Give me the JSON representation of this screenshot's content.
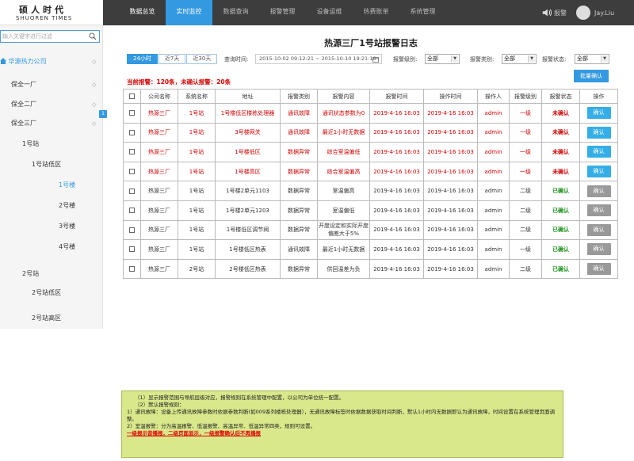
{
  "logo": {
    "cn": "硕人时代",
    "en": "SHUOREN TIMES"
  },
  "nav": [
    {
      "label": "数据总览"
    },
    {
      "label": "实时监控"
    },
    {
      "label": "数据查询"
    },
    {
      "label": "报警管理"
    },
    {
      "label": "设备运维"
    },
    {
      "label": "热费账单"
    },
    {
      "label": "系统管理"
    }
  ],
  "header": {
    "alarm": "报警",
    "user": "Jay.Liu"
  },
  "sidebar": {
    "search_placeholder": "输入关键字进行过滤",
    "company": "华源热力公司",
    "items": [
      "保全一厂",
      "保全二厂",
      "保全三厂",
      "1号站",
      "1号站低区",
      "1号楼",
      "2号楼",
      "3号楼",
      "4号楼",
      "2号站",
      "2号站低区",
      "2号站高区"
    ],
    "badge": "1"
  },
  "panel": {
    "title": "热源三厂1号站报警日志",
    "tabs": [
      "24小时",
      "近7天",
      "近30天"
    ],
    "query_label": "查询时间:",
    "date_range": "2015-10-02 09:12:21 ~ 2015-10-10 19:21:10",
    "level_label": "报警级别:",
    "type_label": "报警类别:",
    "status_label": "报警状态:",
    "select_value": "全部",
    "summary": "当前报警：120条，未确认报警：20条",
    "batch_confirm": "批量确认"
  },
  "table": {
    "headers": [
      "公司名称",
      "系统名称",
      "地址",
      "报警类别",
      "报警内容",
      "报警时间",
      "操作时间",
      "操作人",
      "报警级别",
      "报警状态",
      "操作"
    ],
    "confirm_label": "确认",
    "rows": [
      {
        "company": "热源三厂",
        "system": "1号站",
        "address": "1号楼低区楼栋处理器",
        "type": "通讯故障",
        "content": "通讯状态参数为0",
        "alarm_time": "2019-4-16 16:03",
        "op_time": "2019-4-16 16:03",
        "operator": "admin",
        "level": "一级",
        "status": "未确认"
      },
      {
        "company": "热源三厂",
        "system": "1号站",
        "address": "3号楼网关",
        "type": "通讯故障",
        "content": "最近1小时无数据",
        "alarm_time": "2019-4-16 16:03",
        "op_time": "2019-4-16 16:03",
        "operator": "admin",
        "level": "一级",
        "status": "未确认"
      },
      {
        "company": "热源三厂",
        "system": "1号站",
        "address": "1号楼低区",
        "type": "数据异常",
        "content": "综合室温偏低",
        "alarm_time": "2019-4-16 16:03",
        "op_time": "2019-4-16 16:03",
        "operator": "admin",
        "level": "一级",
        "status": "未确认"
      },
      {
        "company": "热源三厂",
        "system": "1号站",
        "address": "1号楼高区",
        "type": "数据异常",
        "content": "综合室温偏高",
        "alarm_time": "2019-4-16 16:03",
        "op_time": "2019-4-16 16:03",
        "operator": "admin",
        "level": "一级",
        "status": "未确认"
      },
      {
        "company": "热源三厂",
        "system": "1号站",
        "address": "1号楼2单元1103",
        "type": "数据异常",
        "content": "室温偏高",
        "alarm_time": "2019-4-16 16:03",
        "op_time": "2019-4-16 16:03",
        "operator": "admin",
        "level": "二级",
        "status": "已确认"
      },
      {
        "company": "热源三厂",
        "system": "1号站",
        "address": "1号楼2单元1203",
        "type": "数据异常",
        "content": "室温偏低",
        "alarm_time": "2019-4-16 16:03",
        "op_time": "2019-4-16 16:03",
        "operator": "admin",
        "level": "二级",
        "status": "已确认"
      },
      {
        "company": "热源三厂",
        "system": "1号站",
        "address": "1号楼低区调节阀",
        "type": "数据异常",
        "content": "开度设定和实际开度偏差大于5%",
        "alarm_time": "2019-4-16 16:03",
        "op_time": "2019-4-16 16:03",
        "operator": "admin",
        "level": "二级",
        "status": "已确认"
      },
      {
        "company": "热源三厂",
        "system": "1号站",
        "address": "1号楼低区热表",
        "type": "通讯故障",
        "content": "最近1小时无数据",
        "alarm_time": "2019-4-16 16:03",
        "op_time": "2019-4-16 16:03",
        "operator": "admin",
        "level": "一级",
        "status": "已确认"
      },
      {
        "company": "热源三厂",
        "system": "2号站",
        "address": "2号楼低区热表",
        "type": "数据异常",
        "content": "供回温差为负",
        "alarm_time": "2019-4-16 16:03",
        "op_time": "2019-4-16 16:03",
        "operator": "admin",
        "level": "二级",
        "status": "已确认"
      }
    ]
  },
  "note": {
    "lines": [
      "（1）显示报警范围与导航层级对应，报警规则在系统管理中配置，以公司为单位统一配置。",
      "（2）默认报警规则：",
      "1）通讯故障：设备上传通讯故障参数时依据参数判断(如009系列楼栋处理器），无通讯故障标签时依据数据获取时间判断，默认1小时内无数据即认为通讯故障，时间设置在系统管理页面调整。",
      "2）室温报警：分为高温报警、低温报警、高温异常、低温异常四类，规则可设置。"
    ],
    "warning": "一级报示音播报，二级页面显示，一级报警确认后不再播报"
  }
}
